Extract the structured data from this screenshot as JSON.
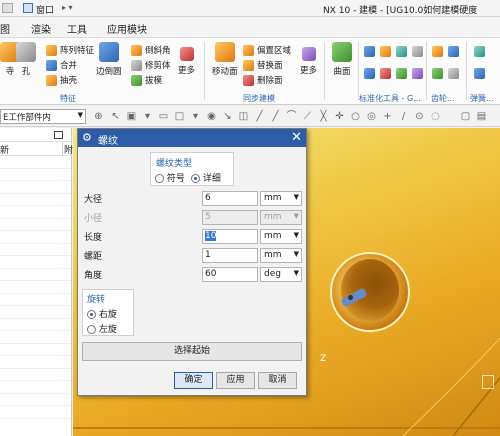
{
  "window": {
    "menu_label": "窗口",
    "qa_symbol": "▸ ▾",
    "title": "NX 10 - 建模 - [UG10.0如何建模硬度"
  },
  "menubar": {
    "tabs": [
      "图",
      "渲染",
      "工具",
      "应用模块"
    ]
  },
  "ribbon": {
    "feature_group": {
      "label": "特征",
      "items": {
        "hole": "孔",
        "array": "阵列特征",
        "combine": "合并",
        "extract": "抽壳",
        "edge_blend": "边倒圆",
        "chamfer": "倒斜角",
        "trim": "修剪体",
        "draft": "拔模",
        "more": "更多",
        "left_clip": "寺"
      }
    },
    "sync_group": {
      "label": "同步建模",
      "items": {
        "move_face": "移动面",
        "offset": "偏置区域",
        "replace": "替换面",
        "delete": "删除面",
        "more": "更多"
      }
    },
    "surface_label": "曲面",
    "std_label": "标准化工具 - G...",
    "gear_label": "齿轮...",
    "spring_label": "弹簧..."
  },
  "selbar": {
    "filter_text": "E工作部件内"
  },
  "navigator": {
    "col_name": "新",
    "col_b": "附"
  },
  "dialog": {
    "title": "螺纹",
    "type_caption": "螺纹类型",
    "type_symbol": "符号",
    "type_detailed": "详细",
    "fields": [
      {
        "label": "大径",
        "value": "6",
        "unit": "mm"
      },
      {
        "label": "小径",
        "value": "5",
        "unit": "mm"
      },
      {
        "label": "长度",
        "value": "10",
        "unit": "mm"
      },
      {
        "label": "螺距",
        "value": "1",
        "unit": "mm"
      },
      {
        "label": "角度",
        "value": "60",
        "unit": "deg"
      }
    ],
    "rotation_caption": "旋转",
    "rotation_right": "右旋",
    "rotation_left": "左旋",
    "select_start": "选择起始",
    "ok": "确定",
    "apply": "应用",
    "cancel": "取消"
  },
  "graphics": {
    "triad_label": "Z"
  }
}
